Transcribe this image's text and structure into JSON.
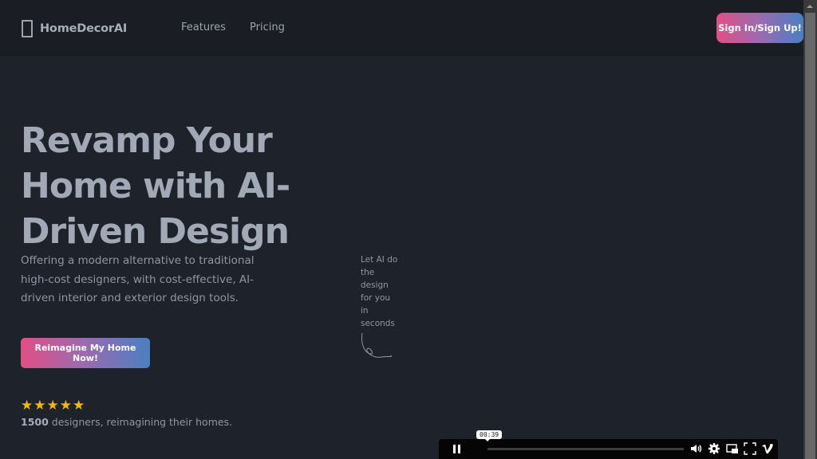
{
  "header": {
    "logo_icon": "door-rectangle-icon",
    "brand": "HomeDecorAI",
    "nav": [
      {
        "label": "Features"
      },
      {
        "label": "Pricing"
      }
    ],
    "signin_label": "Sign In/Sign Up!"
  },
  "hero": {
    "title": "Revamp Your Home with AI-Driven Design",
    "subtitle": "Offering a modern alternative to traditional high-cost designers, with cost-effective, AI-driven interior and exterior design tools.",
    "cta_label": "Reimagine My Home Now!",
    "rating": {
      "stars": 5,
      "max": 5
    },
    "designer_count": "1500",
    "designer_text": " designers, reimagining their homes."
  },
  "annotation": {
    "text": "Let AI do the design for you in seconds",
    "icon": "curly-arrow-icon"
  },
  "video": {
    "time": "00:39",
    "state": "playing",
    "progress_percent": 0,
    "controls": [
      "pause-icon",
      "volume-icon",
      "settings-icon",
      "picture-in-picture-icon",
      "fullscreen-icon",
      "vimeo-icon"
    ]
  },
  "colors": {
    "background": "#1e232b",
    "header": "#1a1d24",
    "gradient_start": "#e24f86",
    "gradient_end": "#4a7fc3",
    "star": "#f5b50a"
  }
}
